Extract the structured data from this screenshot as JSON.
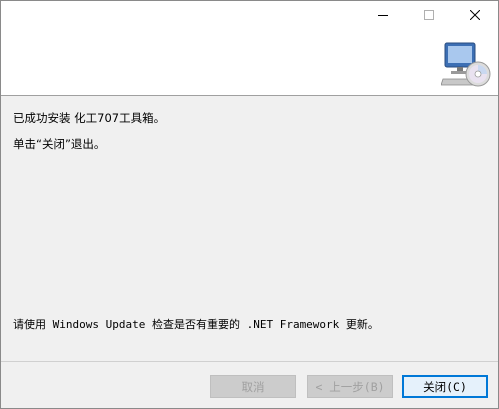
{
  "titlebar": {
    "minimize_glyph": "–",
    "maximize_glyph": "☐",
    "close_glyph": "✕"
  },
  "banner": {
    "icon": "computer-cd-icon"
  },
  "content": {
    "line1": "已成功安装 化工707工具箱。",
    "line2": "单击“关闭”退出。",
    "line3": "请使用 Windows Update 检查是否有重要的 .NET Framework 更新。"
  },
  "buttons": {
    "cancel": "取消",
    "back": "< 上一步(B)",
    "close": "关闭(C)"
  },
  "colors": {
    "accent": "#0078d7",
    "dialog_bg": "#f0f0f0",
    "banner_bg": "#ffffff"
  }
}
